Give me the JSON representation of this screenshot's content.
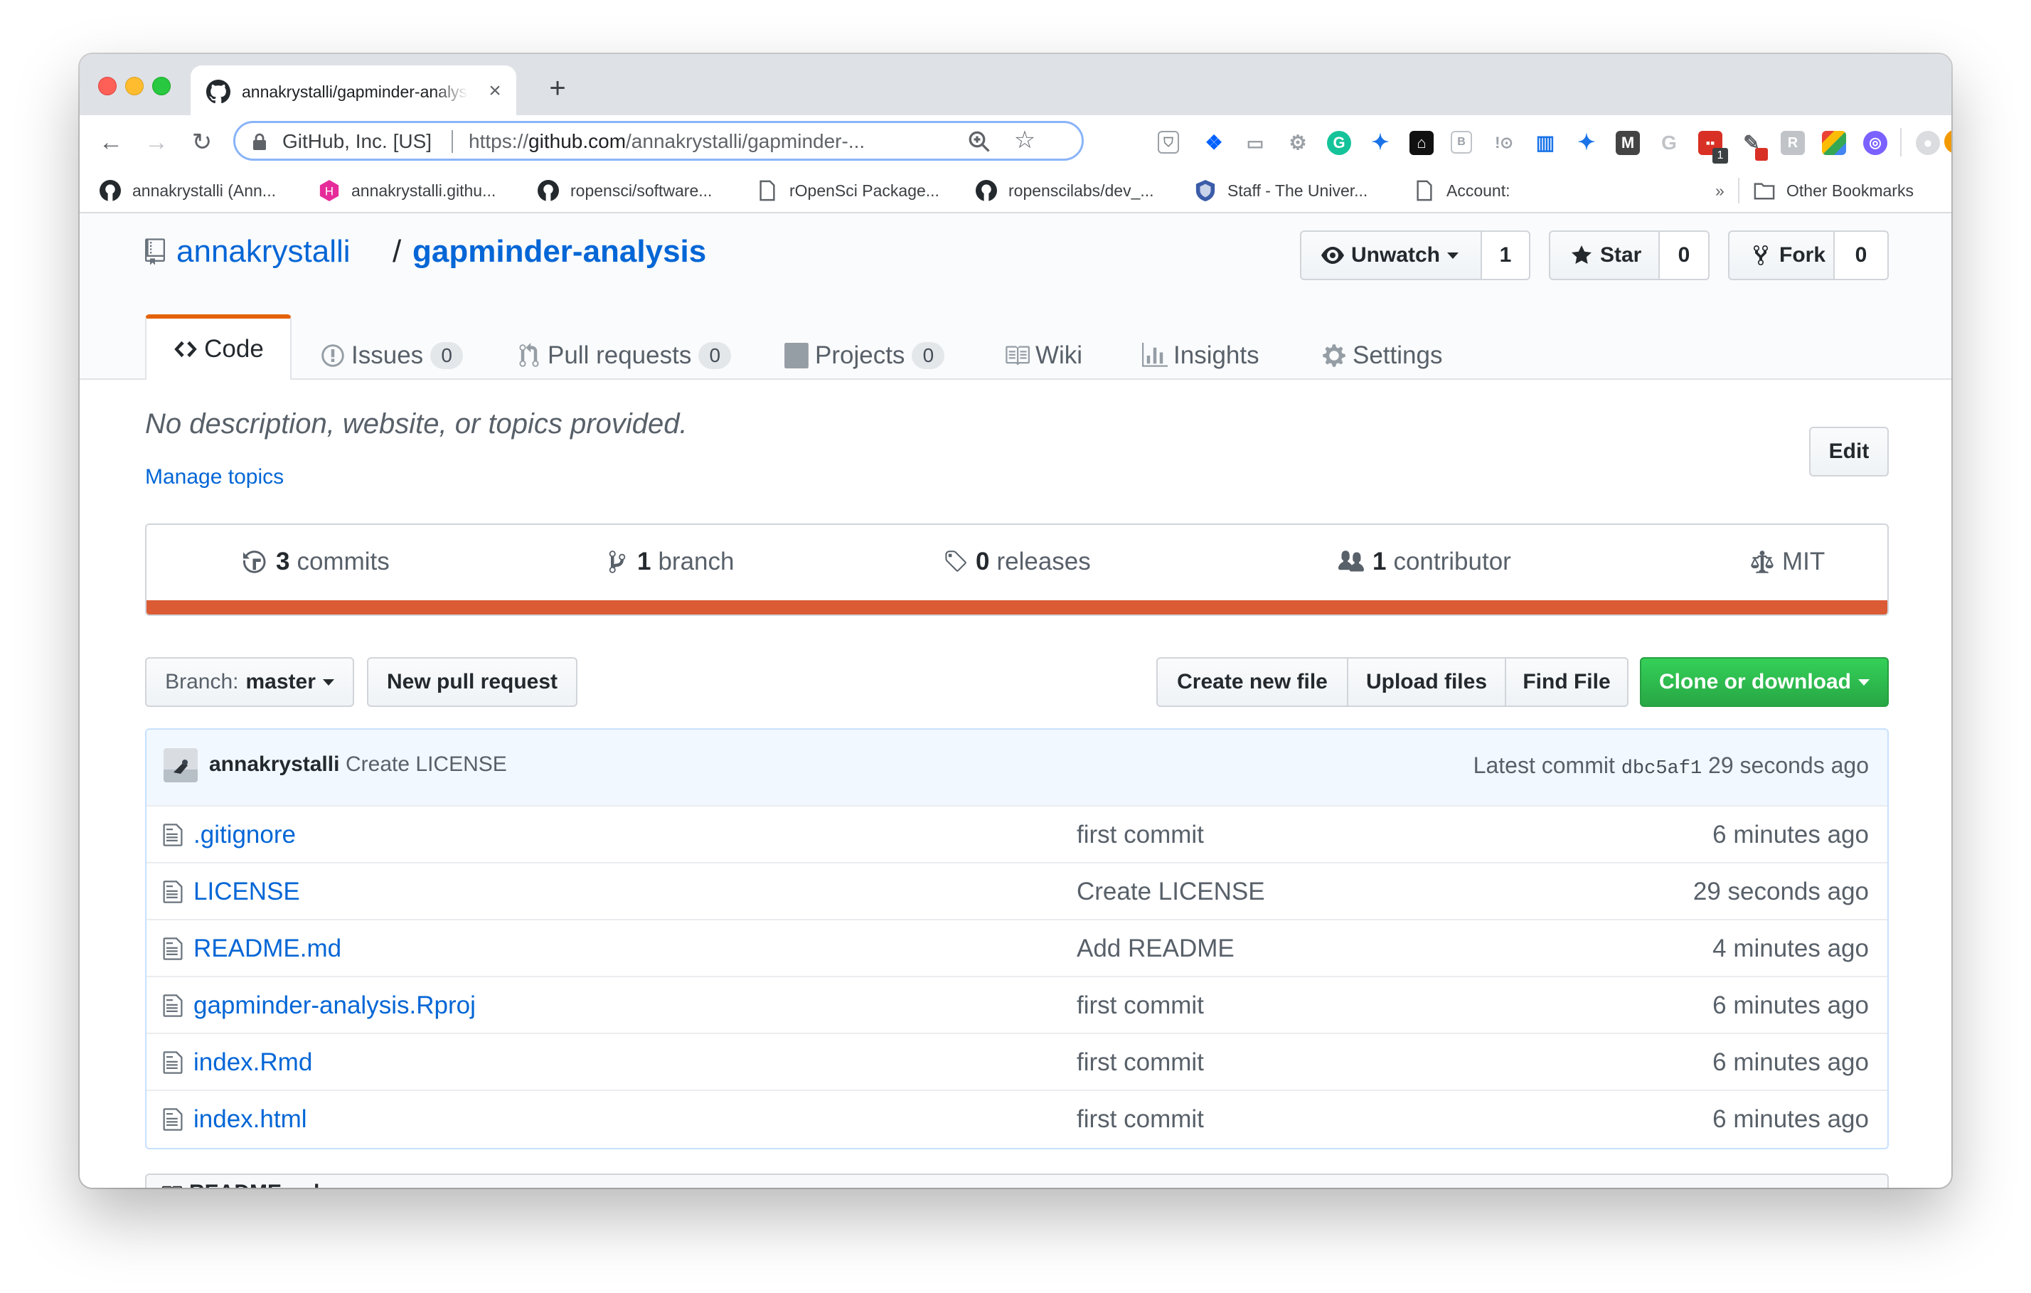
{
  "browser": {
    "tab_title": "annakrystalli/gapminder-analysis",
    "site_identity": "GitHub, Inc. [US]",
    "url_prefix": "https://",
    "url_host": "github.com",
    "url_path": "/annakrystalli/gapminder-...",
    "bookmarks": [
      "annakrystalli (Ann...",
      "annakrystalli.githu...",
      "ropensci/software...",
      "rOpenSci Package...",
      "ropenscilabs/dev_...",
      "Staff - The Univer...",
      "Account:"
    ],
    "bookmarks_overflow": "»",
    "other_bookmarks": "Other Bookmarks",
    "extension_badge": "1"
  },
  "repo": {
    "owner": "annakrystalli",
    "separator": "/",
    "name": "gapminder-analysis",
    "unwatch_label": "Unwatch",
    "watch_count": "1",
    "star_label": "Star",
    "star_count": "0",
    "fork_label": "Fork",
    "fork_count": "0"
  },
  "tabs": [
    {
      "label": "Code"
    },
    {
      "label": "Issues",
      "count": "0"
    },
    {
      "label": "Pull requests",
      "count": "0"
    },
    {
      "label": "Projects",
      "count": "0"
    },
    {
      "label": "Wiki"
    },
    {
      "label": "Insights"
    },
    {
      "label": "Settings"
    }
  ],
  "about": {
    "description": "No description, website, or topics provided.",
    "manage_topics": "Manage topics",
    "edit_label": "Edit"
  },
  "summary": {
    "commits_count": "3",
    "commits_label": "commits",
    "branch_count": "1",
    "branch_label": "branch",
    "releases_count": "0",
    "releases_label": "releases",
    "contributor_count": "1",
    "contributor_label": "contributor",
    "license": "MIT",
    "language_color": "#da5b34"
  },
  "controls": {
    "branch_prefix": "Branch:",
    "branch_name": "master",
    "new_pull_request": "New pull request",
    "create_new_file": "Create new file",
    "upload_files": "Upload files",
    "find_file": "Find File",
    "clone_or_download": "Clone or download"
  },
  "latest_commit": {
    "author": "annakrystalli",
    "message": "Create LICENSE",
    "prefix": "Latest commit",
    "sha": "dbc5af1",
    "age": "29 seconds ago"
  },
  "files": [
    {
      "name": ".gitignore",
      "message": "first commit",
      "age": "6 minutes ago"
    },
    {
      "name": "LICENSE",
      "message": "Create LICENSE",
      "age": "29 seconds ago"
    },
    {
      "name": "README.md",
      "message": "Add README",
      "age": "4 minutes ago"
    },
    {
      "name": "gapminder-analysis.Rproj",
      "message": "first commit",
      "age": "6 minutes ago"
    },
    {
      "name": "index.Rmd",
      "message": "first commit",
      "age": "6 minutes ago"
    },
    {
      "name": "index.html",
      "message": "first commit",
      "age": "6 minutes ago"
    }
  ],
  "readme": {
    "title": "README.md"
  }
}
